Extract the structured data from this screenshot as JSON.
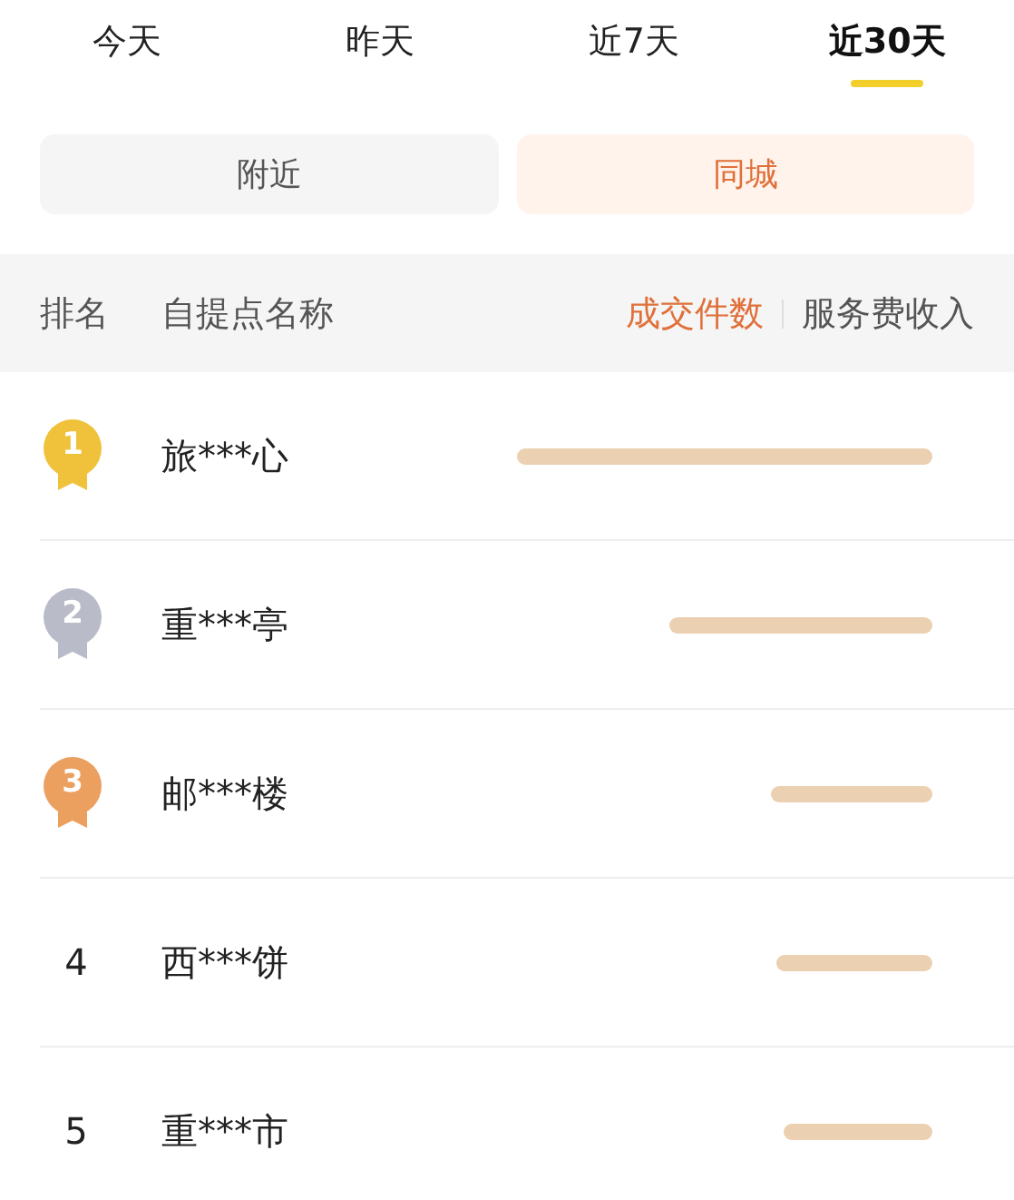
{
  "period_tabs": [
    {
      "label": "今天",
      "selected": false
    },
    {
      "label": "昨天",
      "selected": false
    },
    {
      "label": "近7天",
      "selected": false
    },
    {
      "label": "近30天",
      "selected": true
    }
  ],
  "scope_tabs": [
    {
      "label": "附近",
      "selected": false
    },
    {
      "label": "同城",
      "selected": true
    }
  ],
  "table": {
    "columns": [
      "排名",
      "自提点名称"
    ],
    "sort_options": [
      {
        "label": "成交件数",
        "selected": true
      },
      {
        "label": "服务费收入",
        "selected": false
      }
    ],
    "rows": [
      {
        "rank": "1",
        "kind": "medal",
        "color": "#f0c23c",
        "name": "旅***心"
      },
      {
        "rank": "2",
        "kind": "medal",
        "color": "#b9bcc8",
        "name": "重***亭"
      },
      {
        "rank": "3",
        "kind": "medal",
        "color": "#eba060",
        "name": "邮***楼"
      },
      {
        "rank": "4",
        "kind": "plain",
        "name": "西***饼"
      },
      {
        "rank": "5",
        "kind": "plain",
        "name": "重***市"
      }
    ]
  }
}
